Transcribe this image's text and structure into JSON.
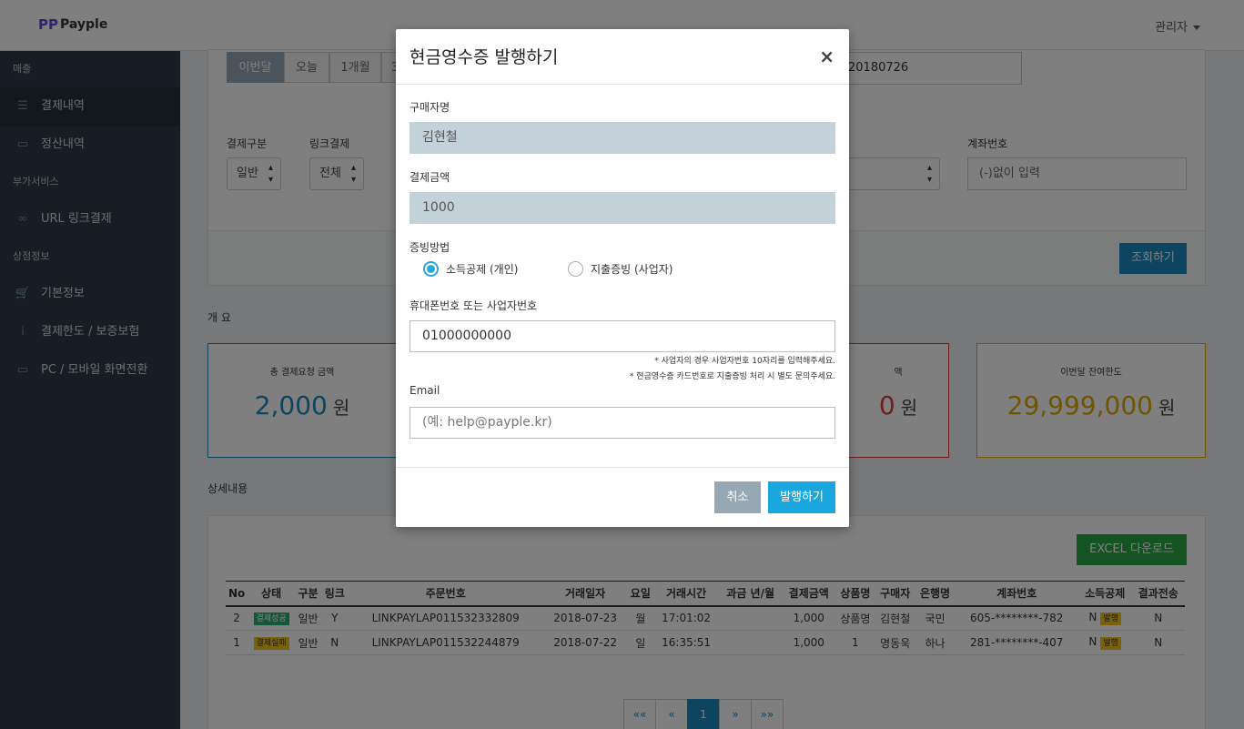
{
  "header": {
    "logo": "Payple",
    "admin": "관리자"
  },
  "sidebar": {
    "sections": [
      {
        "title": "매출",
        "items": [
          {
            "label": "결제내역",
            "icon": "list-icon"
          },
          {
            "label": "정산내역",
            "icon": "money-icon"
          }
        ]
      },
      {
        "title": "부가서비스",
        "items": [
          {
            "label": "URL 링크결제",
            "icon": "link-icon"
          }
        ]
      },
      {
        "title": "상점정보",
        "items": [
          {
            "label": "기본정보",
            "icon": "cart-icon"
          },
          {
            "label": "결제한도 / 보증보험",
            "icon": "info-icon"
          },
          {
            "label": "PC / 모바일 화면전환",
            "icon": "monitor-icon"
          }
        ]
      }
    ]
  },
  "filters": {
    "periods": [
      "이번달",
      "오늘",
      "1개월",
      "3"
    ],
    "date_to": "20180726",
    "pay_type_label": "결제구분",
    "pay_type_value": "일반",
    "link_label": "링크결제",
    "link_value": "전체",
    "account_label": "계좌번호",
    "account_placeholder": "(-)없이 입력",
    "query_button": "조회하기"
  },
  "summary": {
    "title": "개 요",
    "total_label": "총 결제요청 금액",
    "total_value": "2,000",
    "mid_label": "액",
    "mid_value": "0",
    "remain_label": "이번달 잔여한도",
    "remain_value": "29,999,000",
    "unit": "원"
  },
  "detail": {
    "title": "상세내용",
    "excel_button": "EXCEL 다운로드",
    "columns": [
      "No",
      "상태",
      "구분",
      "링크",
      "주문번호",
      "거래일자",
      "요일",
      "거래시간",
      "과금 년/월",
      "결제금액",
      "상품명",
      "구매자",
      "은행명",
      "계좌번호",
      "소득공제",
      "결과전송"
    ],
    "rows": [
      {
        "no": "2",
        "status": "결제성공",
        "type": "일반",
        "link": "Y",
        "order": "LINKPAYLAP011532332809",
        "date": "2018-07-23",
        "day": "월",
        "time": "17:01:02",
        "billing": "",
        "amount": "1,000",
        "product": "상품명",
        "buyer": "김현철",
        "bank": "국민",
        "account": "605-********-782",
        "deduct": "N",
        "deduct_tag": "발행",
        "result": "N"
      },
      {
        "no": "1",
        "status": "결제실패",
        "type": "일반",
        "link": "N",
        "order": "LINKPAYLAP011532244879",
        "date": "2018-07-22",
        "day": "일",
        "time": "16:35:51",
        "billing": "",
        "amount": "1,000",
        "product": "1",
        "buyer": "명동욱",
        "bank": "하나",
        "account": "281-********-407",
        "deduct": "N",
        "deduct_tag": "발행",
        "result": "N"
      }
    ],
    "pager": [
      "««",
      "«",
      "1",
      "»",
      "»»"
    ]
  },
  "modal": {
    "title": "현금영수증 발행하기",
    "close": "×",
    "buyer_label": "구매자명",
    "buyer_value": "김현철",
    "amount_label": "결제금액",
    "amount_value": "1000",
    "method_label": "증빙방법",
    "method_options": [
      "소득공제 (개인)",
      "지출증빙 (사업자)"
    ],
    "method_selected": "소득공제 (개인)",
    "phone_label": "휴대폰번호 또는 사업자번호",
    "phone_value": "01000000000",
    "note1": "* 사업자의 경우 사업자번호 10자리를 입력해주세요.",
    "note2": "* 현금영수증 카드번호로 지출증빙 처리 시 별도 문의주세요.",
    "email_label": "Email",
    "email_placeholder": "(예: help@payple.kr)",
    "cancel_button": "취소",
    "issue_button": "발행하기"
  },
  "colors": {
    "sidebar_bg": "#2f3a45",
    "primary": "#1aa7e0",
    "total_blue": "#1b8ac3",
    "remain_gold": "#e0a800",
    "danger_red": "#e03a3a",
    "success_green": "#28a745"
  }
}
